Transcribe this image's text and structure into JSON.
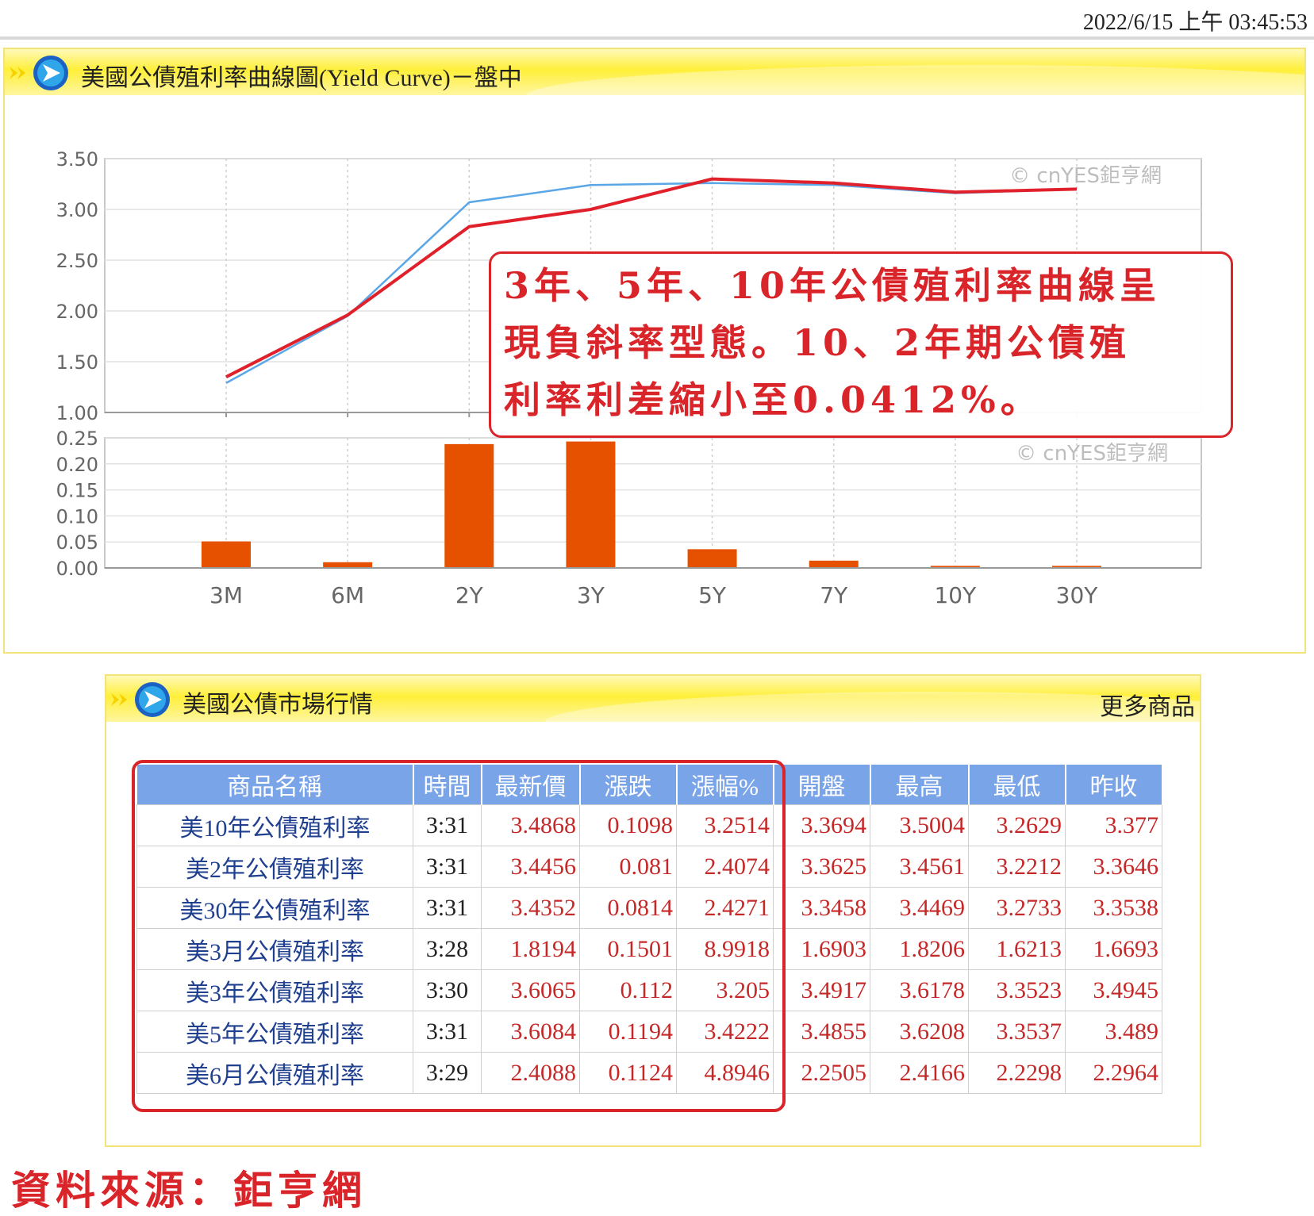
{
  "timestamp": "2022/6/15 上午 03:45:53",
  "chart_panel": {
    "title": "美國公債殖利率曲線圖(Yield Curve)－盤中"
  },
  "watermark": "© cnYES鉅亨網",
  "annotation": [
    "3年、5年、10年公債殖利率曲線呈",
    "現負斜率型態。10、2年期公債殖",
    "利率利差縮小至0.0412%。"
  ],
  "chart_data": [
    {
      "type": "line",
      "categories": [
        "3M",
        "6M",
        "2Y",
        "3Y",
        "5Y",
        "7Y",
        "10Y",
        "30Y"
      ],
      "ylim": [
        1.0,
        3.5
      ],
      "yticks": [
        "1.00",
        "1.50",
        "2.00",
        "2.50",
        "3.00",
        "3.50"
      ],
      "series": [
        {
          "values": [
            1.35,
            1.96,
            2.83,
            3.0,
            3.3,
            3.26,
            3.17,
            3.2
          ],
          "color": "#e0202a"
        },
        {
          "values": [
            1.29,
            1.95,
            3.07,
            3.24,
            3.26,
            3.24,
            3.16,
            3.2
          ],
          "color": "#5aa6e6"
        }
      ],
      "grid": true
    },
    {
      "type": "bar",
      "categories": [
        "3M",
        "6M",
        "2Y",
        "3Y",
        "5Y",
        "7Y",
        "10Y",
        "30Y"
      ],
      "values": [
        0.051,
        0.011,
        0.238,
        0.243,
        0.036,
        0.014,
        0.004,
        0.004
      ],
      "ylim": [
        0.0,
        0.25
      ],
      "yticks": [
        "0.00",
        "0.05",
        "0.10",
        "0.15",
        "0.20",
        "0.25"
      ],
      "color": "#e65100",
      "grid": true
    }
  ],
  "table_panel": {
    "title": "美國公債市場行情",
    "more_link": "更多商品"
  },
  "table": {
    "headers": [
      "商品名稱",
      "時間",
      "最新價",
      "漲跌",
      "漲幅%",
      "開盤",
      "最高",
      "最低",
      "昨收"
    ],
    "rows": [
      [
        "美10年公債殖利率",
        "3:31",
        "3.4868",
        "0.1098",
        "3.2514",
        "3.3694",
        "3.5004",
        "3.2629",
        "3.377"
      ],
      [
        "美2年公債殖利率",
        "3:31",
        "3.4456",
        "0.081",
        "2.4074",
        "3.3625",
        "3.4561",
        "3.2212",
        "3.3646"
      ],
      [
        "美30年公債殖利率",
        "3:31",
        "3.4352",
        "0.0814",
        "2.4271",
        "3.3458",
        "3.4469",
        "3.2733",
        "3.3538"
      ],
      [
        "美3月公債殖利率",
        "3:28",
        "1.8194",
        "0.1501",
        "8.9918",
        "1.6903",
        "1.8206",
        "1.6213",
        "1.6693"
      ],
      [
        "美3年公債殖利率",
        "3:30",
        "3.6065",
        "0.112",
        "3.205",
        "3.4917",
        "3.6178",
        "3.3523",
        "3.4945"
      ],
      [
        "美5年公債殖利率",
        "3:31",
        "3.6084",
        "0.1194",
        "3.4222",
        "3.4855",
        "3.6208",
        "3.3537",
        "3.489"
      ],
      [
        "美6月公債殖利率",
        "3:29",
        "2.4088",
        "0.1124",
        "4.8946",
        "2.2505",
        "2.4166",
        "2.2298",
        "2.2964"
      ]
    ]
  },
  "source": "資料來源：鉅亨網"
}
